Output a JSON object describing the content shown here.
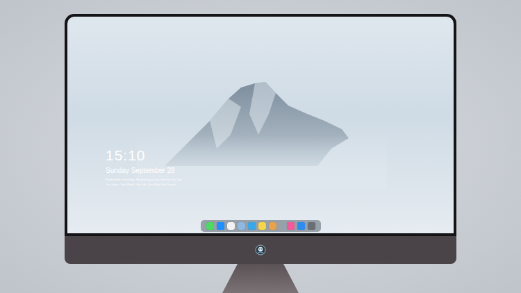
{
  "lock_screen": {
    "time": "15:10",
    "date": "Sunday September 28",
    "caption_lines": [
      "Powered by technology, Shaped by passion, Built for You, Yes",
      "Your Ideas, Your World, Your Life, Your Way, Your Dream"
    ]
  },
  "dock": {
    "items": [
      {
        "kind": "app",
        "color": "#4cd964"
      },
      {
        "kind": "app",
        "color": "#1e90ff"
      },
      {
        "kind": "app",
        "color": "#f2f2f2"
      },
      {
        "kind": "app",
        "color": "#8fb8e0"
      },
      {
        "kind": "app",
        "color": "#3aa7e8"
      },
      {
        "kind": "app",
        "color": "#f7d54a"
      },
      {
        "kind": "app",
        "color": "#e8a24c"
      },
      {
        "kind": "separator",
        "color": "#9aa0a6"
      },
      {
        "kind": "app",
        "color": "#f25a9b"
      },
      {
        "kind": "app",
        "color": "#2d8cf0"
      },
      {
        "kind": "app",
        "color": "#6b6f75"
      }
    ]
  }
}
